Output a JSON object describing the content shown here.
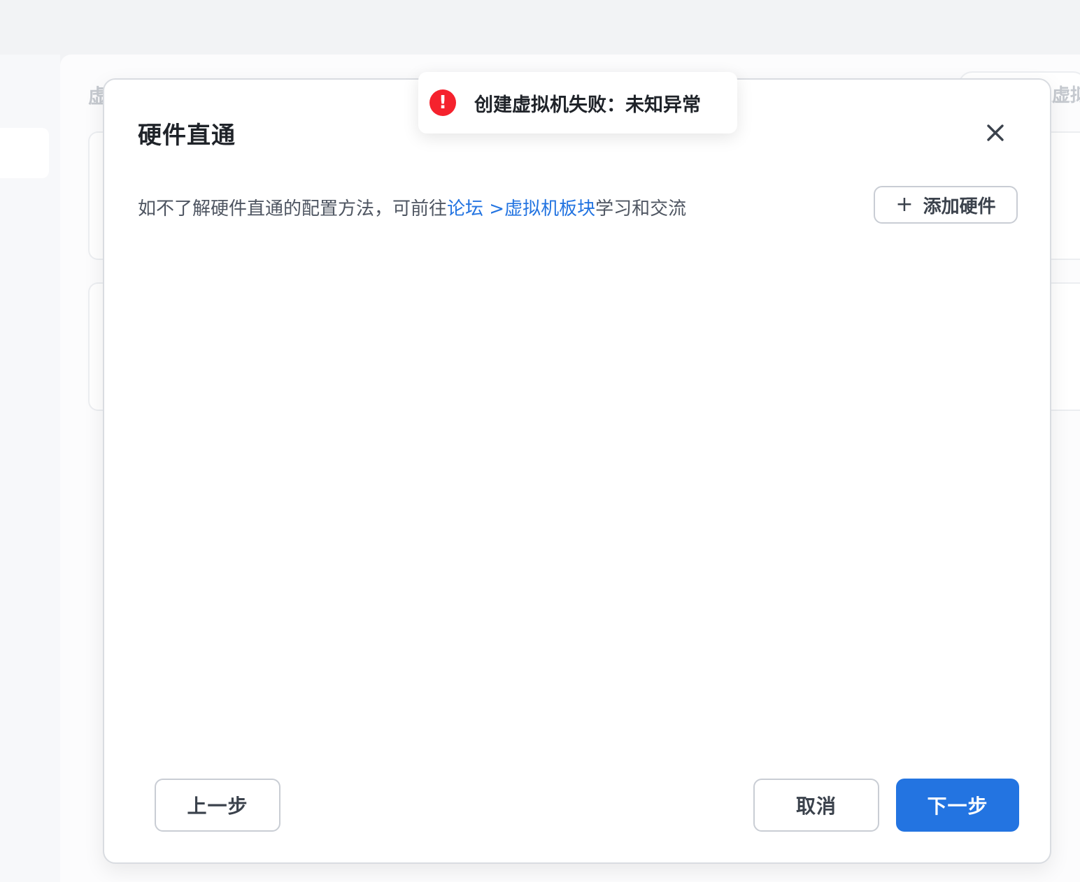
{
  "background": {
    "heading_left": "虚",
    "heading_right": "虚拟"
  },
  "dialog": {
    "title": "硬件直通",
    "description": {
      "prefix": "如不了解硬件直通的配置方法，可前往",
      "link": "论坛 >虚拟机板块",
      "suffix": "学习和交流"
    },
    "add_button": {
      "icon": "+",
      "label": "添加硬件"
    },
    "footer": {
      "prev_label": "上一步",
      "cancel_label": "取消",
      "next_label": "下一步"
    }
  },
  "toast": {
    "icon": "!",
    "message": "创建虚拟机失败：未知异常",
    "type": "error"
  },
  "colors": {
    "accent": "#2374e1",
    "error": "#f5222d",
    "text": "#1f2329"
  }
}
